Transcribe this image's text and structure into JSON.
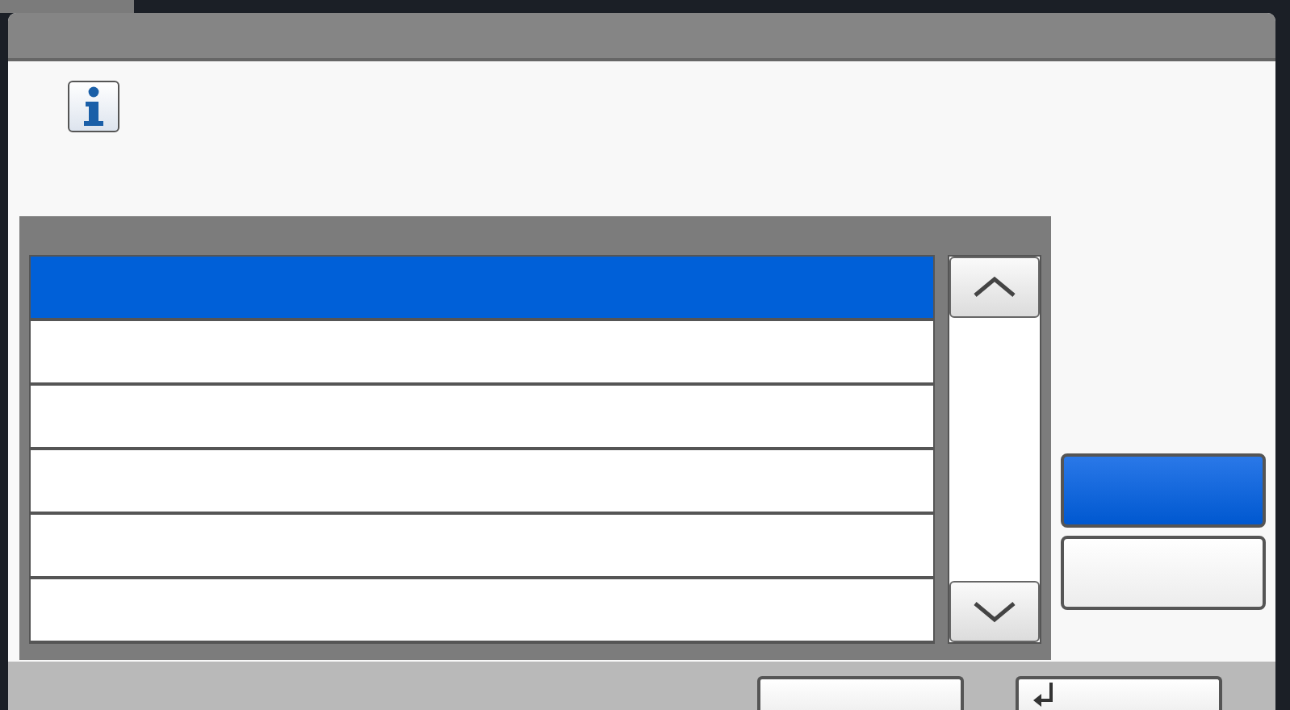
{
  "list": {
    "rows": [
      {
        "selected": true
      },
      {
        "selected": false
      },
      {
        "selected": false
      },
      {
        "selected": false
      },
      {
        "selected": false
      },
      {
        "selected": false
      }
    ]
  },
  "side_buttons": [
    {
      "selected": true
    },
    {
      "selected": false
    }
  ],
  "footer_buttons": [
    {
      "kind": "plain"
    },
    {
      "kind": "enter"
    }
  ]
}
